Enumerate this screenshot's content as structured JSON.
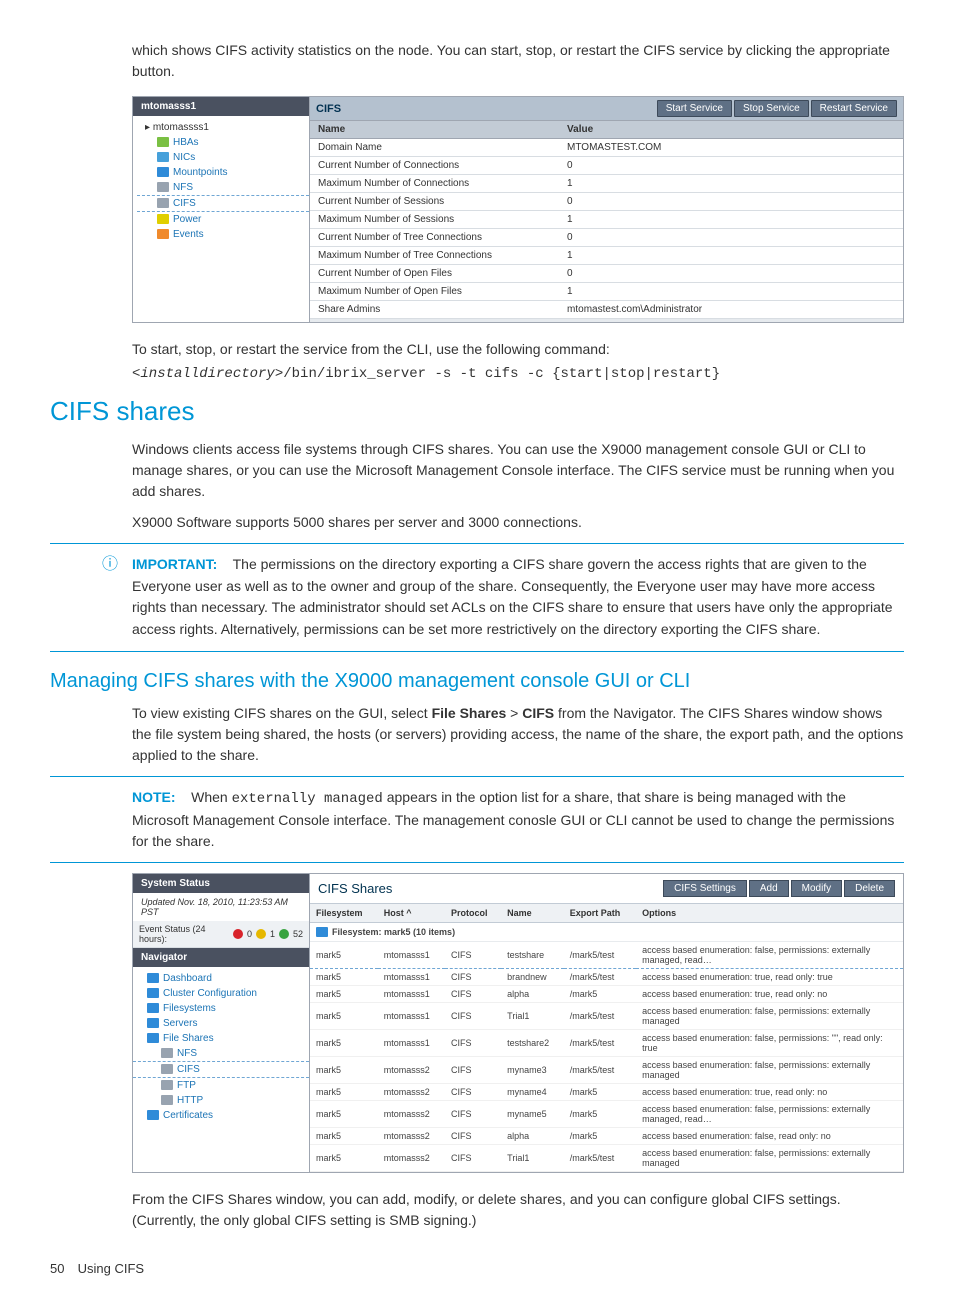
{
  "intro_text": "which shows CIFS activity statistics on the node. You can start, stop, or restart the CIFS service by clicking the appropriate button.",
  "shot1": {
    "tree_header": "mtomasss1",
    "tree_root": "mtomassss1",
    "tree_items": [
      "HBAs",
      "NICs",
      "Mountpoints",
      "NFS",
      "CIFS",
      "Power",
      "Events"
    ],
    "panel_title": "CIFS",
    "buttons": [
      "Start Service",
      "Stop Service",
      "Restart Service"
    ],
    "cols": [
      "Name",
      "Value"
    ],
    "rows": [
      {
        "name": "Domain Name",
        "value": "MTOMASTEST.COM"
      },
      {
        "name": "Current Number of Connections",
        "value": "0"
      },
      {
        "name": "Maximum Number of Connections",
        "value": "1"
      },
      {
        "name": "Current Number of Sessions",
        "value": "0"
      },
      {
        "name": "Maximum Number of Sessions",
        "value": "1"
      },
      {
        "name": "Current Number of Tree Connections",
        "value": "0"
      },
      {
        "name": "Maximum Number of Tree Connections",
        "value": "1"
      },
      {
        "name": "Current Number of Open Files",
        "value": "0"
      },
      {
        "name": "Maximum Number of Open Files",
        "value": "1"
      },
      {
        "name": "Share Admins",
        "value": "mtomastest.com\\Administrator"
      }
    ]
  },
  "cli_intro": "To start, stop, or restart the service from the CLI, use the following command:",
  "cli_prefix": "<installdirectory>",
  "cli_cmd": "/bin/ibrix_server -s -t cifs -c {start|stop|restart}",
  "h_cifs_shares": "CIFS shares",
  "p1": "Windows clients access file systems through CIFS shares. You can use the X9000 management console GUI or CLI to manage shares, or you can use the Microsoft Management Console interface. The CIFS service must be running when you add shares.",
  "p2": "X9000 Software supports 5000 shares per server and 3000 connections.",
  "imp_label": "IMPORTANT:",
  "imp_text": "The permissions on the directory exporting a CIFS share govern the access rights that are given to the Everyone user as well as to the owner and group of the share. Consequently, the Everyone user may have more access rights than necessary. The administrator should set ACLs on the CIFS share to ensure that users have only the appropriate access rights. Alternatively, permissions can be set more restrictively on the directory exporting the CIFS share.",
  "h_manage": "Managing CIFS shares with the X9000 management console GUI or CLI",
  "p3a": "To view existing CIFS shares on the GUI, select ",
  "p3b": "File Shares",
  "p3c": " > ",
  "p3d": "CIFS",
  "p3e": " from the Navigator. The CIFS Shares window shows the file system being shared, the hosts (or servers) providing access, the name of the share, the export path, and the options applied to the share.",
  "note_label": "NOTE:",
  "note_pre": "When ",
  "note_mono": "externally managed",
  "note_post": " appears in the option list for a share, that share is being managed with the Microsoft Management Console interface. The management conosle GUI or CLI cannot be used to change the permissions for the share.",
  "shot2": {
    "sys_status_hdr": "System Status",
    "updated": "Updated Nov. 18, 2010, 11:23:53 AM PST",
    "event_label": "Event Status (24 hours):",
    "event_vals": [
      "0",
      "1",
      "52"
    ],
    "navigator_hdr": "Navigator",
    "nav_items": [
      {
        "label": "Dashboard",
        "cls": ""
      },
      {
        "label": "Cluster Configuration",
        "cls": ""
      },
      {
        "label": "Filesystems",
        "cls": ""
      },
      {
        "label": "Servers",
        "cls": ""
      },
      {
        "label": "File Shares",
        "cls": ""
      },
      {
        "label": "NFS",
        "cls": "sub"
      },
      {
        "label": "CIFS",
        "cls": "sub selected"
      },
      {
        "label": "FTP",
        "cls": "sub"
      },
      {
        "label": "HTTP",
        "cls": "sub"
      },
      {
        "label": "Certificates",
        "cls": ""
      }
    ],
    "panel_title": "CIFS Shares",
    "buttons": [
      "CIFS Settings",
      "Add",
      "Modify",
      "Delete"
    ],
    "headers": [
      "Filesystem",
      "Host ^",
      "Protocol",
      "Name",
      "Export Path",
      "Options"
    ],
    "group": "Filesystem: mark5 (10 items)",
    "rows": [
      {
        "fs": "mark5",
        "host": "mtomasss1",
        "proto": "CIFS",
        "name": "testshare",
        "path": "/mark5/test",
        "opts": "access based enumeration: false, permissions: externally managed, read…",
        "sel": true
      },
      {
        "fs": "mark5",
        "host": "mtomasss1",
        "proto": "CIFS",
        "name": "brandnew",
        "path": "/mark5/test",
        "opts": "access based enumeration: true, read only: true"
      },
      {
        "fs": "mark5",
        "host": "mtomasss1",
        "proto": "CIFS",
        "name": "alpha",
        "path": "/mark5",
        "opts": "access based enumeration: true, read only: no"
      },
      {
        "fs": "mark5",
        "host": "mtomasss1",
        "proto": "CIFS",
        "name": "Trial1",
        "path": "/mark5/test",
        "opts": "access based enumeration: false, permissions: externally managed"
      },
      {
        "fs": "mark5",
        "host": "mtomasss1",
        "proto": "CIFS",
        "name": "testshare2",
        "path": "/mark5/test",
        "opts": "access based enumeration: false, permissions: \"\", read only: true"
      },
      {
        "fs": "mark5",
        "host": "mtomasss2",
        "proto": "CIFS",
        "name": "myname3",
        "path": "/mark5/test",
        "opts": "access based enumeration: false, permissions: externally managed"
      },
      {
        "fs": "mark5",
        "host": "mtomasss2",
        "proto": "CIFS",
        "name": "myname4",
        "path": "/mark5",
        "opts": "access based enumeration: true, read only: no"
      },
      {
        "fs": "mark5",
        "host": "mtomasss2",
        "proto": "CIFS",
        "name": "myname5",
        "path": "/mark5",
        "opts": "access based enumeration: false, permissions: externally managed, read…"
      },
      {
        "fs": "mark5",
        "host": "mtomasss2",
        "proto": "CIFS",
        "name": "alpha",
        "path": "/mark5",
        "opts": "access based enumeration: false, read only: no"
      },
      {
        "fs": "mark5",
        "host": "mtomasss2",
        "proto": "CIFS",
        "name": "Trial1",
        "path": "/mark5/test",
        "opts": "access based enumeration: false, permissions: externally managed"
      }
    ]
  },
  "closing": "From the CIFS Shares window, you can add, modify, or delete shares, and you can configure global CIFS settings. (Currently, the only global CIFS setting is SMB signing.)",
  "footer_num": "50",
  "footer_text": "Using CIFS"
}
